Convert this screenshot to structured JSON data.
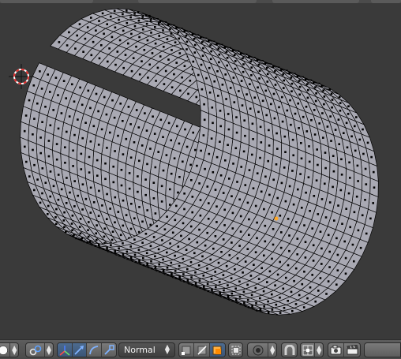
{
  "viewport": {
    "background": "#3a3a3a",
    "mesh_face_color": "#a9a9b3",
    "mesh_edge_color": "#000000",
    "origin_color": "#ffa726",
    "cursor": {
      "ring_color": "#ff2a2a",
      "alt_color": "#ffffff"
    }
  },
  "toolbar": {
    "pivot_icon": "sphere-icon",
    "snap_icon": "link-rings-icon",
    "transform_manipulator_icons": [
      "axis-manipulator-icon",
      "translate-arrow-icon",
      "rotate-arc-icon",
      "scale-handle-icon"
    ],
    "orientation": {
      "value": "Normal"
    },
    "select_mode_icons": [
      "vertex-select-icon",
      "edge-select-icon",
      "face-select-icon"
    ],
    "occlude_icon": "occlude-geometry-icon",
    "proportional_icon": "proportional-dot-icon",
    "magnet_icon": "magnet-icon",
    "snap_element_icon": "snap-increment-icon",
    "render_icons": [
      "camera-icon",
      "clapperboard-icon"
    ]
  }
}
